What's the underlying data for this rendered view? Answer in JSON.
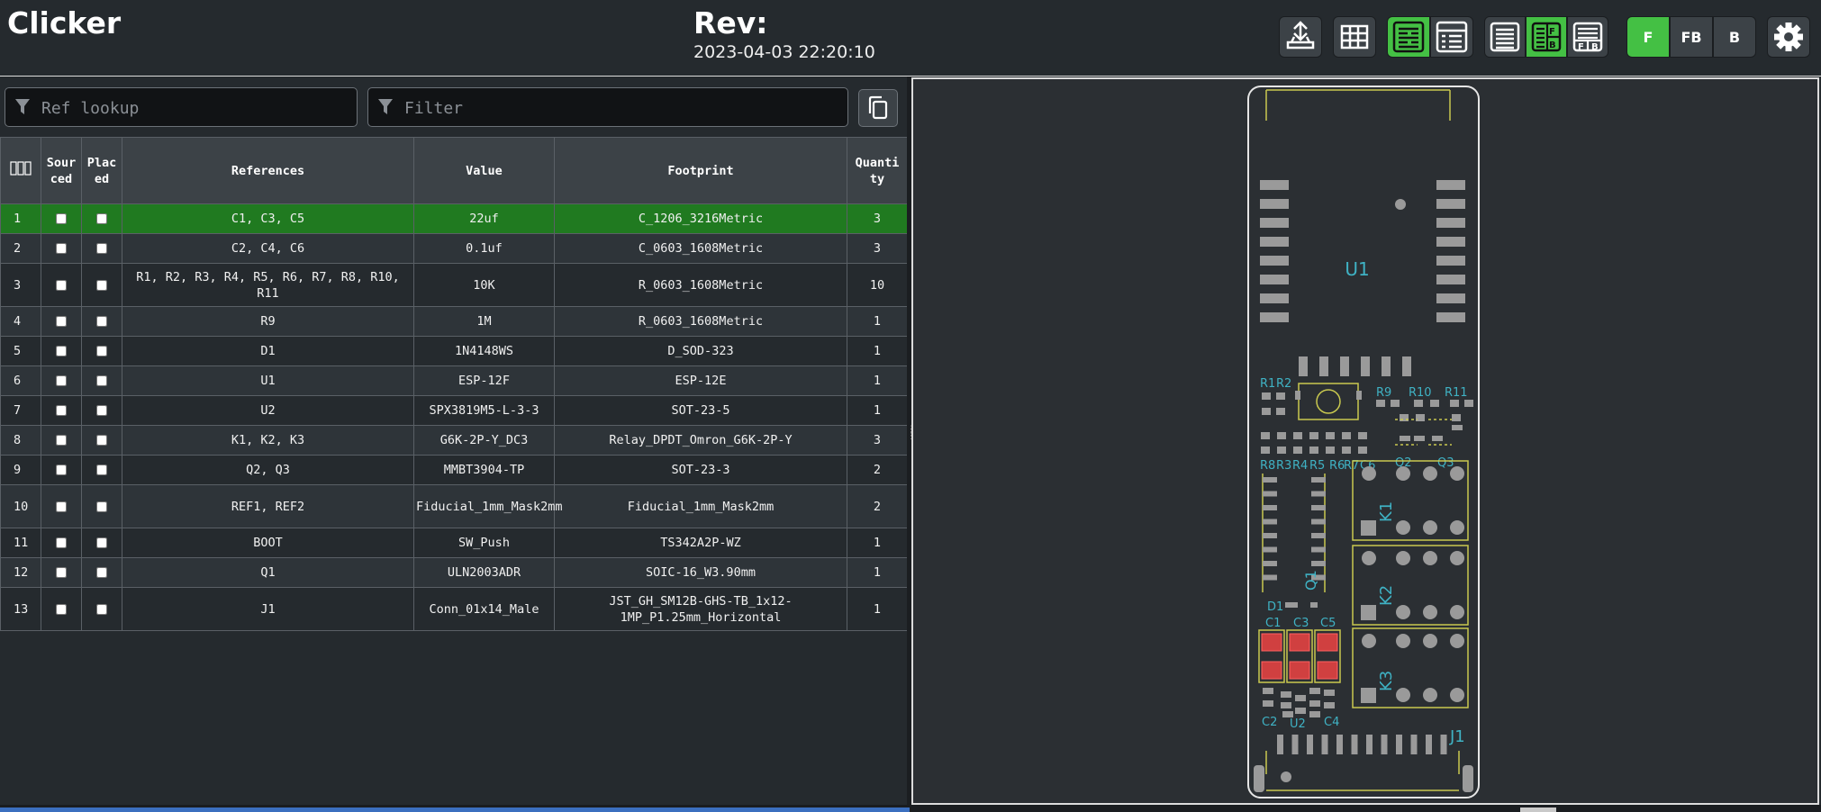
{
  "header": {
    "title": "Clicker",
    "rev_label": "Rev:",
    "date": "2023-04-03 22:20:10"
  },
  "toolbar": {
    "layer_buttons": [
      {
        "label": "F",
        "active": true
      },
      {
        "label": "FB",
        "active": false
      },
      {
        "label": "B",
        "active": false
      }
    ],
    "icons": [
      "upload-icon",
      "grid-icon",
      "bom-left-right-icon",
      "bom-top-bottom-icon",
      "list-icon",
      "fb-split-icon",
      "fb-stacked-icon",
      "gear-icon"
    ],
    "accent_color": "#44c044"
  },
  "filters": {
    "ref_lookup_placeholder": "Ref lookup",
    "filter_placeholder": "Filter"
  },
  "bom": {
    "columns": [
      "Sourced",
      "Placed",
      "References",
      "Value",
      "Footprint",
      "Quantity"
    ],
    "col_sourced": "Sour ced",
    "col_placed": "Plac ed",
    "col_references": "References",
    "col_value": "Value",
    "col_footprint": "Footprint",
    "col_quantity": "Quanti ty",
    "rows": [
      {
        "num": "1",
        "references": "C1, C3, C5",
        "value": "22uf",
        "footprint": "C_1206_3216Metric",
        "quantity": "3"
      },
      {
        "num": "2",
        "references": "C2, C4, C6",
        "value": "0.1uf",
        "footprint": "C_0603_1608Metric",
        "quantity": "3"
      },
      {
        "num": "3",
        "references": "R1, R2, R3, R4, R5, R6, R7, R8, R10, R11",
        "value": "10K",
        "footprint": "R_0603_1608Metric",
        "quantity": "10"
      },
      {
        "num": "4",
        "references": "R9",
        "value": "1M",
        "footprint": "R_0603_1608Metric",
        "quantity": "1"
      },
      {
        "num": "5",
        "references": "D1",
        "value": "1N4148WS",
        "footprint": "D_SOD-323",
        "quantity": "1"
      },
      {
        "num": "6",
        "references": "U1",
        "value": "ESP-12F",
        "footprint": "ESP-12E",
        "quantity": "1"
      },
      {
        "num": "7",
        "references": "U2",
        "value": "SPX3819M5-L-3-3",
        "footprint": "SOT-23-5",
        "quantity": "1"
      },
      {
        "num": "8",
        "references": "K1, K2, K3",
        "value": "G6K-2P-Y_DC3",
        "footprint": "Relay_DPDT_Omron_G6K-2P-Y",
        "quantity": "3"
      },
      {
        "num": "9",
        "references": "Q2, Q3",
        "value": "MMBT3904-TP",
        "footprint": "SOT-23-3",
        "quantity": "2"
      },
      {
        "num": "10",
        "references": "REF1, REF2",
        "value": "Fiducial_1mm_Mask2mm",
        "footprint": "Fiducial_1mm_Mask2mm",
        "quantity": "2"
      },
      {
        "num": "11",
        "references": "BOOT",
        "value": "SW_Push",
        "footprint": "TS342A2P-WZ",
        "quantity": "1"
      },
      {
        "num": "12",
        "references": "Q1",
        "value": "ULN2003ADR",
        "footprint": "SOIC-16_W3.90mm",
        "quantity": "1"
      },
      {
        "num": "13",
        "references": "J1",
        "value": "Conn_01x14_Male",
        "footprint": "JST_GH_SM12B-GHS-TB_1x12-1MP_P1.25mm_Horizontal",
        "quantity": "1"
      }
    ],
    "highlight_color": "#207a20"
  },
  "pcb": {
    "labels": {
      "U1": "U1",
      "R1": "R1",
      "R2": "R2",
      "R9": "R9",
      "R10": "R10",
      "R11": "R11",
      "R8": "R8",
      "R3": "R3",
      "R4": "R4",
      "R5": "R5",
      "R6": "R6",
      "R7": "R7",
      "C6": "C6",
      "Q2": "Q2",
      "Q3": "Q3",
      "K1": "K1",
      "K2": "K2",
      "K3": "K3",
      "Q1": "Q1",
      "D1": "D1",
      "C1": "C1",
      "C3": "C3",
      "C5": "C5",
      "C2": "C2",
      "U2": "U2",
      "C4": "C4",
      "J1": "J1"
    },
    "highlight_color": "#d04040"
  }
}
